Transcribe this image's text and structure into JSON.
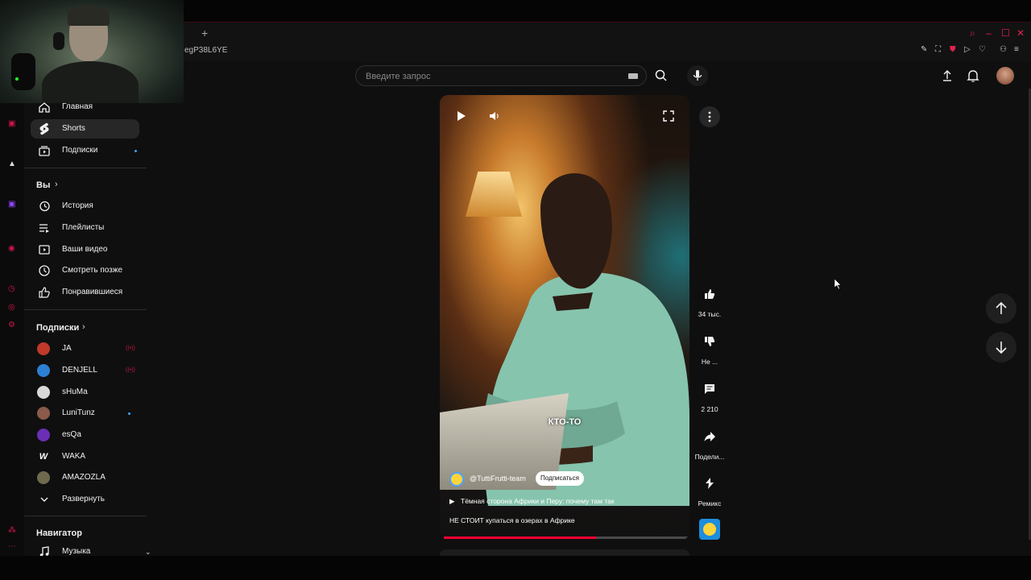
{
  "browser": {
    "new_tab": "+",
    "url_fragment": "egP38L6YE"
  },
  "header": {
    "search_placeholder": "Введите запрос",
    "icons": [
      "keyboard-icon",
      "search-icon",
      "mic-icon",
      "upload-icon",
      "bell-icon",
      "user-avatar"
    ]
  },
  "sidebar": {
    "main": [
      {
        "label": "Главная",
        "icon": "home-icon"
      },
      {
        "label": "Shorts",
        "icon": "shorts-icon",
        "active": true
      },
      {
        "label": "Подписки",
        "icon": "subscriptions-icon",
        "new": true
      }
    ],
    "you_title": "Вы",
    "you_items": [
      {
        "label": "История",
        "icon": "history-icon"
      },
      {
        "label": "Плейлисты",
        "icon": "playlist-icon"
      },
      {
        "label": "Ваши видео",
        "icon": "your-videos-icon"
      },
      {
        "label": "Смотреть позже",
        "icon": "watch-later-icon"
      },
      {
        "label": "Понравившиеся",
        "icon": "liked-icon"
      }
    ],
    "subs_title": "Подписки",
    "subscriptions": [
      {
        "label": "JA",
        "color": "#c0392b",
        "live": true
      },
      {
        "label": "DENJELL",
        "color": "#2d7fd3",
        "live": true
      },
      {
        "label": "sHuMa",
        "color": "#d8d8d8"
      },
      {
        "label": "LuniTunz",
        "color": "#8a5a4a",
        "new": true
      },
      {
        "label": "esQa",
        "color": "#6b2fb5"
      },
      {
        "label": "WAKA",
        "color": "#0f0f0f"
      },
      {
        "label": "AMAZOZLA",
        "color": "#6d6a4e"
      }
    ],
    "expand_label": "Развернуть",
    "nav_title": "Навигатор",
    "nav_items": [
      {
        "label": "Музыка",
        "icon": "music-icon"
      }
    ]
  },
  "video": {
    "caption": "КТО-ТО",
    "channel": "@TuttiFrutti-team",
    "subscribe_label": "Подписаться",
    "title_line1": "Тёмная сторона Африки и Перу: почему там так",
    "title_line2": "НЕ СТОИТ купаться в озерах в Африке",
    "progress": 0.62
  },
  "actions": {
    "likes": "34 тыс.",
    "dislike": "Не ...",
    "comments": "2 210",
    "share": "Подели...",
    "remix": "Ремикс"
  },
  "colors": {
    "accent": "#ff0033",
    "browser_accent": "#e0234a",
    "background": "#0f0f0f"
  }
}
